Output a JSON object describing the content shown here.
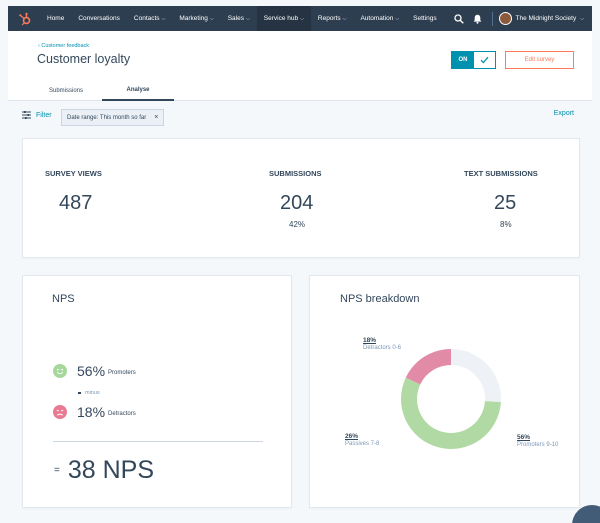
{
  "nav": {
    "items": [
      {
        "label": "Home",
        "caret": false,
        "active": false
      },
      {
        "label": "Conversations",
        "caret": false,
        "active": false
      },
      {
        "label": "Contacts",
        "caret": true,
        "active": false
      },
      {
        "label": "Marketing",
        "caret": true,
        "active": false
      },
      {
        "label": "Sales",
        "caret": true,
        "active": false
      },
      {
        "label": "Service hub",
        "caret": true,
        "active": true
      },
      {
        "label": "Reports",
        "caret": true,
        "active": false
      },
      {
        "label": "Automation",
        "caret": true,
        "active": false
      },
      {
        "label": "Settings",
        "caret": false,
        "active": false
      }
    ],
    "account": "The Midnight Society",
    "caret_glyph": "⌵",
    "icons": [
      "hubspot-logo",
      "search-icon",
      "bell-icon",
      "avatar"
    ]
  },
  "header": {
    "breadcrumb": "‹ Customer feedback",
    "title": "Customer loyalty",
    "toggle_label": "ON",
    "edit_button": "Edit survey",
    "tabs": [
      "Submissions",
      "Analyse"
    ]
  },
  "filter": {
    "label": "Filter",
    "chip": "Date range: This month so far",
    "chip_close": "×",
    "export": "Export"
  },
  "stats": [
    {
      "label": "SURVEY VIEWS",
      "value": "487",
      "pct": ""
    },
    {
      "label": "SUBMISSIONS",
      "value": "204",
      "pct": "42%"
    },
    {
      "label": "TEXT SUBMISSIONS",
      "value": "25",
      "pct": "8%"
    }
  ],
  "nps": {
    "title": "NPS",
    "promoters_pct": "56%",
    "promoters_label": "Promoters",
    "minus_label": "minus",
    "detractors_pct": "18%",
    "detractors_label": "Detractors",
    "equals": "=",
    "score": "38 NPS"
  },
  "breakdown": {
    "title": "NPS breakdown",
    "segments": [
      {
        "pct_label": "18%",
        "name": "Detractors 0-6",
        "value": 18,
        "color": "#e28ba6"
      },
      {
        "pct_label": "26%",
        "name": "Passives 7-8",
        "value": 26,
        "color": "#eef1f6"
      },
      {
        "pct_label": "56%",
        "name": "Promoters 9-10",
        "value": 56,
        "color": "#b0d9a3"
      }
    ]
  },
  "colors": {
    "nav_bg": "#2d3e50",
    "accent": "#0091ae",
    "edit": "#ff7a59",
    "promoter": "#a5d89a",
    "detractor": "#e87a93"
  }
}
